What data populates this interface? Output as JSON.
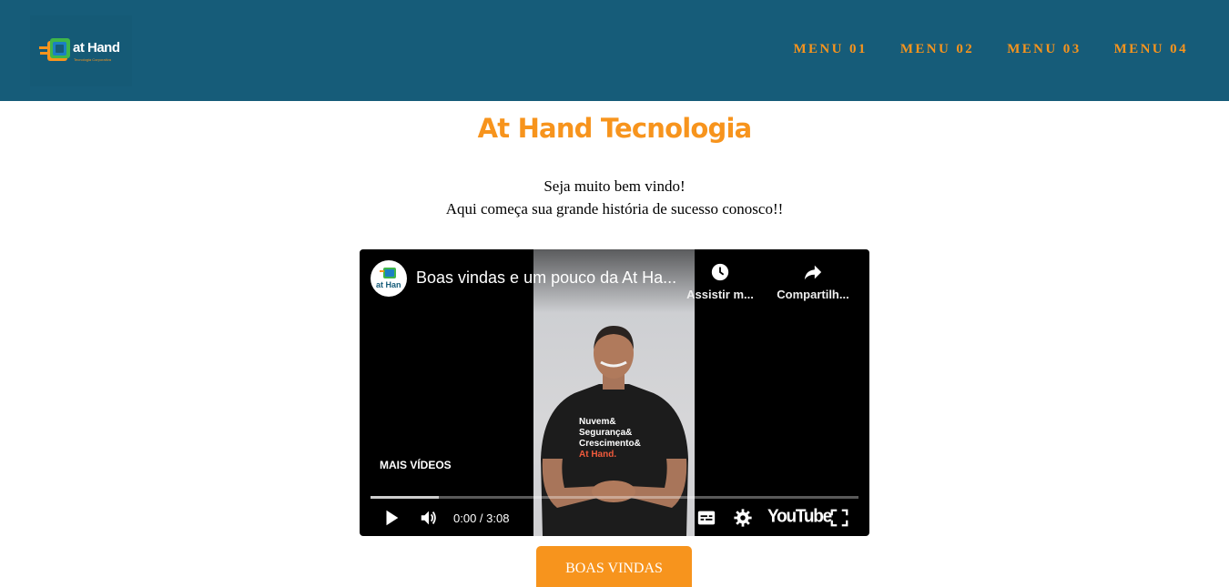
{
  "header": {
    "logo": {
      "name": "at Hand",
      "tagline": "Tecnologia Corporativa"
    },
    "nav": [
      "MENU 01",
      "MENU 02",
      "MENU 03",
      "MENU 04"
    ]
  },
  "main": {
    "title": "At Hand Tecnologia",
    "welcome_line1": "Seja muito bem vindo!",
    "welcome_line2": "Aqui começa sua grande história de sucesso conosco!!"
  },
  "video": {
    "channel_icon": "at Hand",
    "title": "Boas vindas e um pouco da At Ha...",
    "watch_later_label": "Assistir m...",
    "share_label": "Compartilh...",
    "more_videos_label": "MAIS VÍDEOS",
    "time": "0:00 / 3:08",
    "progress_fraction": 0.14,
    "player_brand": "YouTube",
    "shirt_text": [
      "Nuvem&",
      "Segurança&",
      "Crescimento&",
      "At Hand."
    ]
  },
  "cta": {
    "label": "BOAS VINDAS"
  },
  "colors": {
    "header_bg": "#165c79",
    "accent": "#f7941d"
  }
}
